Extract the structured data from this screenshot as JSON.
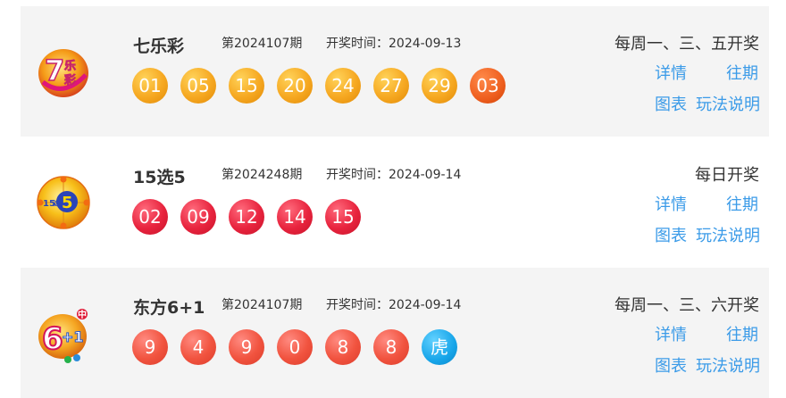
{
  "lotteries": [
    {
      "name": "七乐彩",
      "issue": "第2024107期",
      "draw_time": "开奖时间：2024-09-13",
      "schedule": "每周一、三、五开奖",
      "balls": [
        "01",
        "05",
        "15",
        "20",
        "24",
        "27",
        "29",
        "03"
      ],
      "logo_text": "7乐彩"
    },
    {
      "name": "15选5",
      "issue": "第2024248期",
      "draw_time": "开奖时间：2024-09-14",
      "schedule": "每日开奖",
      "balls": [
        "02",
        "09",
        "12",
        "14",
        "15"
      ],
      "logo_text": "15选5"
    },
    {
      "name": "东方6+1",
      "issue": "第2024107期",
      "draw_time": "开奖时间：2024-09-14",
      "schedule": "每周一、三、六开奖",
      "balls": [
        "9",
        "4",
        "9",
        "0",
        "8",
        "8",
        "虎"
      ],
      "logo_text": "6+1"
    }
  ],
  "links": {
    "detail": "详情",
    "trend": "往期",
    "chart": "图表",
    "rules": "玩法说明"
  },
  "colors": {
    "ball_orange": "#f6a821",
    "ball_special_orange": "#ee5e1e",
    "ball_red": "#e8243e",
    "ball_coral": "#f1533f",
    "ball_zodiac_blue": "#17a5e9",
    "link": "#3b9be8",
    "row_bg": "#f4f4f4"
  }
}
